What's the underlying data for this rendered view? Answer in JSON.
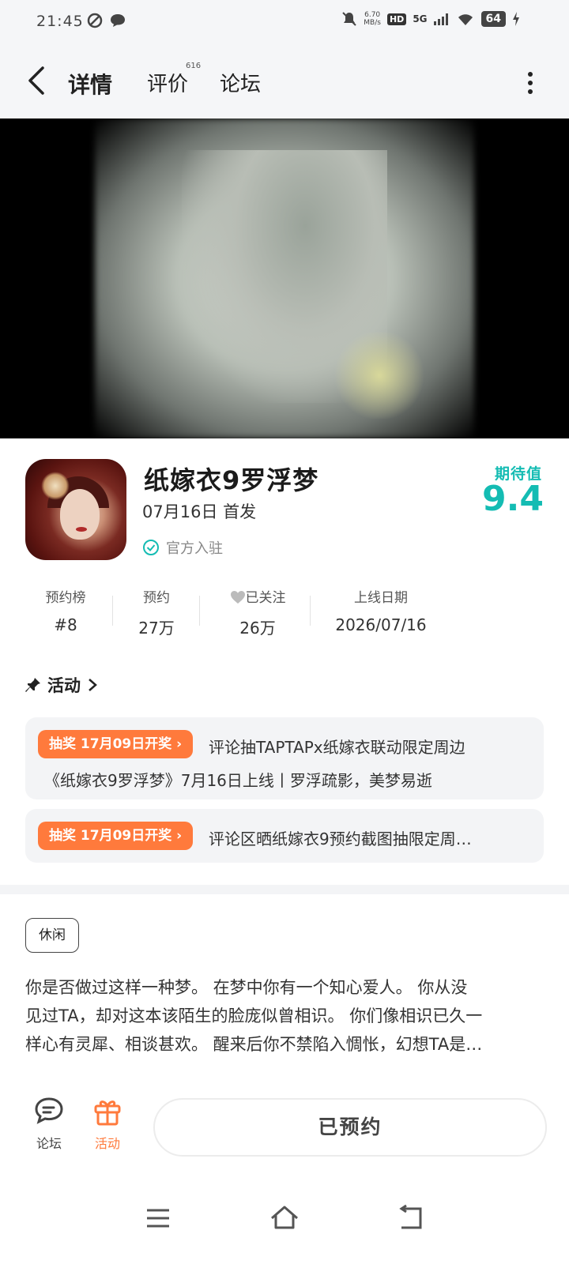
{
  "status_bar": {
    "time": "21:45",
    "speed_value": "6.70",
    "speed_unit": "MB/s",
    "hd": "HD",
    "network": "5G",
    "battery": "64"
  },
  "nav": {
    "tabs": [
      {
        "label": "详情",
        "active": true
      },
      {
        "label": "评价"
      },
      {
        "label": "论坛"
      }
    ],
    "review_count": "616"
  },
  "game": {
    "title": "纸嫁衣9罗浮梦",
    "release": "07月16日 首发",
    "official": "官方入驻",
    "expect_label": "期待值",
    "expect_value": "9.4"
  },
  "stats": [
    {
      "label": "预约榜",
      "value": "#8"
    },
    {
      "label": "预约",
      "value": "27万"
    },
    {
      "label": "已关注",
      "value": "26万"
    },
    {
      "label": "上线日期",
      "value": "2026/07/16"
    }
  ],
  "activities": {
    "header": "活动",
    "items": [
      {
        "badge": "抽奖 17月09日开奖 ›",
        "line1": "评论抽TAPTAPx纸嫁衣联动限定周边",
        "line2": "《纸嫁衣9罗浮梦》7月16日上线丨罗浮疏影，美梦易逝"
      },
      {
        "badge": "抽奖 17月09日开奖 ›",
        "line1": "评论区晒纸嫁衣9预约截图抽限定周…"
      }
    ]
  },
  "tag": "休闲",
  "description": {
    "line1": "你是否做过这样一种梦。 在梦中你有一个知心爱人。 你从没",
    "line2": "见过TA，却对这本该陌生的脸庞似曾相识。 你们像相识已久一",
    "line3": "样心有灵犀、相谈甚欢。 醒来后你不禁陷入惆怅，幻想TA是…"
  },
  "bottom_bar": {
    "forum_label": "论坛",
    "activity_label": "活动",
    "reserve_label": "已预约"
  },
  "colors": {
    "accent_teal": "#14bcb3",
    "accent_orange": "#ff7a3c"
  }
}
